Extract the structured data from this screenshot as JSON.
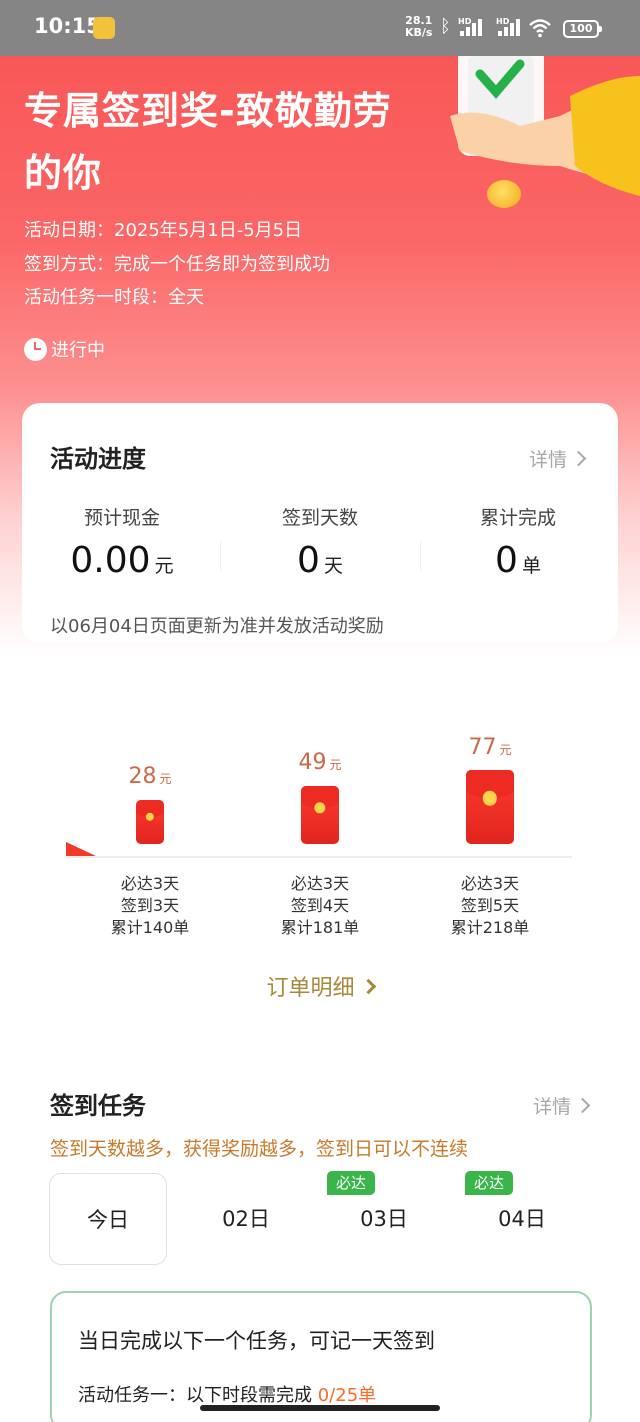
{
  "status_bar": {
    "time": "10:15",
    "speed_value": "28.1",
    "speed_unit": "KB/s",
    "hd_label": "HD",
    "battery": "100"
  },
  "hero": {
    "title": "专属签到奖-致敬勤劳的你",
    "date_line": "活动日期：2025年5月1日-5月5日",
    "method_line": "签到方式：完成一个任务即为签到成功",
    "period_line": "活动任务一时段：全天",
    "status": "进行中"
  },
  "progress_card": {
    "title": "活动进度",
    "detail_label": "详情",
    "stats": [
      {
        "label": "预计现金",
        "value": "0.00",
        "unit": "元"
      },
      {
        "label": "签到天数",
        "value": "0",
        "unit": "天"
      },
      {
        "label": "累计完成",
        "value": "0",
        "unit": "单"
      }
    ],
    "note": "以06月04日页面更新为准并发放活动奖励"
  },
  "milestones": [
    {
      "amount": "28",
      "unit": "元",
      "line1": "必达3天",
      "line2": "签到3天",
      "line3": "累计140单"
    },
    {
      "amount": "49",
      "unit": "元",
      "line1": "必达3天",
      "line2": "签到4天",
      "line3": "累计181单"
    },
    {
      "amount": "77",
      "unit": "元",
      "line1": "必达3天",
      "line2": "签到5天",
      "line3": "累计218单"
    }
  ],
  "order_detail_label": "订单明细",
  "tasks": {
    "title": "签到任务",
    "detail_label": "详情",
    "tip": "签到天数越多，获得奖励越多，签到日可以不连续",
    "days": [
      {
        "label": "今日",
        "badge": ""
      },
      {
        "label": "02日",
        "badge": ""
      },
      {
        "label": "03日",
        "badge": "必达"
      },
      {
        "label": "04日",
        "badge": "必达"
      }
    ],
    "card_title": "当日完成以下一个任务，可记一天签到",
    "line_prefix": "活动任务一：以下时段需完成",
    "line_progress": "0/25单"
  },
  "colors": {
    "hero_red": "#f95757",
    "accent_green": "#39b54a",
    "gold_text": "#a8883a",
    "tip_orange": "#c87a2a"
  }
}
